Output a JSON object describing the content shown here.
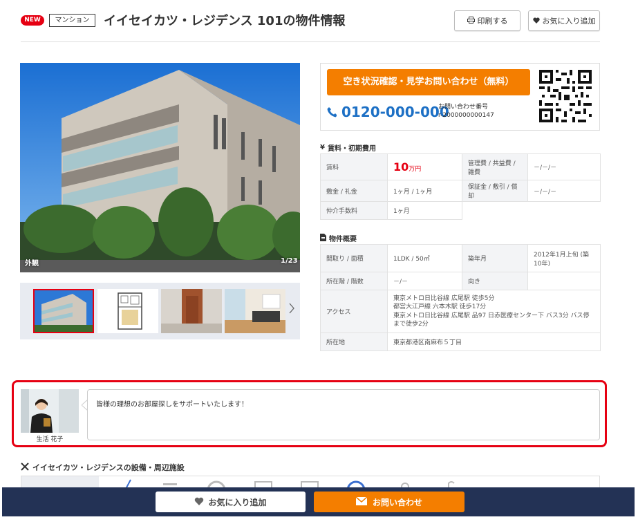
{
  "header": {
    "new_badge": "NEW",
    "type_tag": "マンション",
    "title": "イイセイカツ・レジデンス 101の物件情報",
    "print_label": "印刷する",
    "favorite_label": "お気に入り追加"
  },
  "gallery": {
    "caption": "外観",
    "counter": "1/23",
    "thumbnails": [
      "exterior",
      "floorplan",
      "entrance",
      "interior"
    ]
  },
  "contact": {
    "cta_label": "空き状況確認・見学お問い合わせ（無料）",
    "phone": "0120-000-000",
    "inquiry_label": "お問い合わせ番号",
    "inquiry_number": "r-2000000000147"
  },
  "fees": {
    "heading": "賃料・初期費用",
    "rent_label": "賃料",
    "rent_value": "10",
    "rent_unit": "万円",
    "mgmt_label": "管理費 / 共益費 / 雑費",
    "mgmt_value": "－/－/－",
    "deposit_label": "敷金 / 礼金",
    "deposit_value": "1ヶ月 / 1ヶ月",
    "guarantee_label": "保証金 / 敷引 / 償却",
    "guarantee_value": "－/－/－",
    "brokerage_label": "仲介手数料",
    "brokerage_value": "1ヶ月"
  },
  "overview": {
    "heading": "物件概要",
    "layout_label": "間取り / 面積",
    "layout_value": "1LDK / 50㎡",
    "built_label": "築年月",
    "built_value": "2012年1月上旬 (築10年)",
    "floor_label": "所在階 / 階数",
    "floor_value": "－/－",
    "direction_label": "向き",
    "direction_value": "",
    "access_label": "アクセス",
    "access_lines": [
      "東京メトロ日比谷線 広尾駅 徒歩5分",
      "都営大江戸線 六本木駅 徒歩17分",
      "東京メトロ日比谷線 広尾駅 品97 日赤医療センター下 バス3分 バス停まで徒歩2分"
    ],
    "address_label": "所在地",
    "address_value": "東京都港区南麻布５丁目"
  },
  "agent": {
    "name": "生活 花子",
    "message": "皆様の理想のお部屋探しをサポートいたします！"
  },
  "facilities": {
    "heading": "イイセイカツ・レジデンスの設備・周辺施設"
  },
  "bottom_bar": {
    "favorite_label": "お気に入り追加",
    "inquiry_label": "お問い合わせ"
  },
  "colors": {
    "accent_orange": "#f47e00",
    "price_red": "#e60012",
    "phone_blue": "#1d70c5",
    "bottom_navy": "#233255",
    "highlight_red": "#e60012"
  }
}
